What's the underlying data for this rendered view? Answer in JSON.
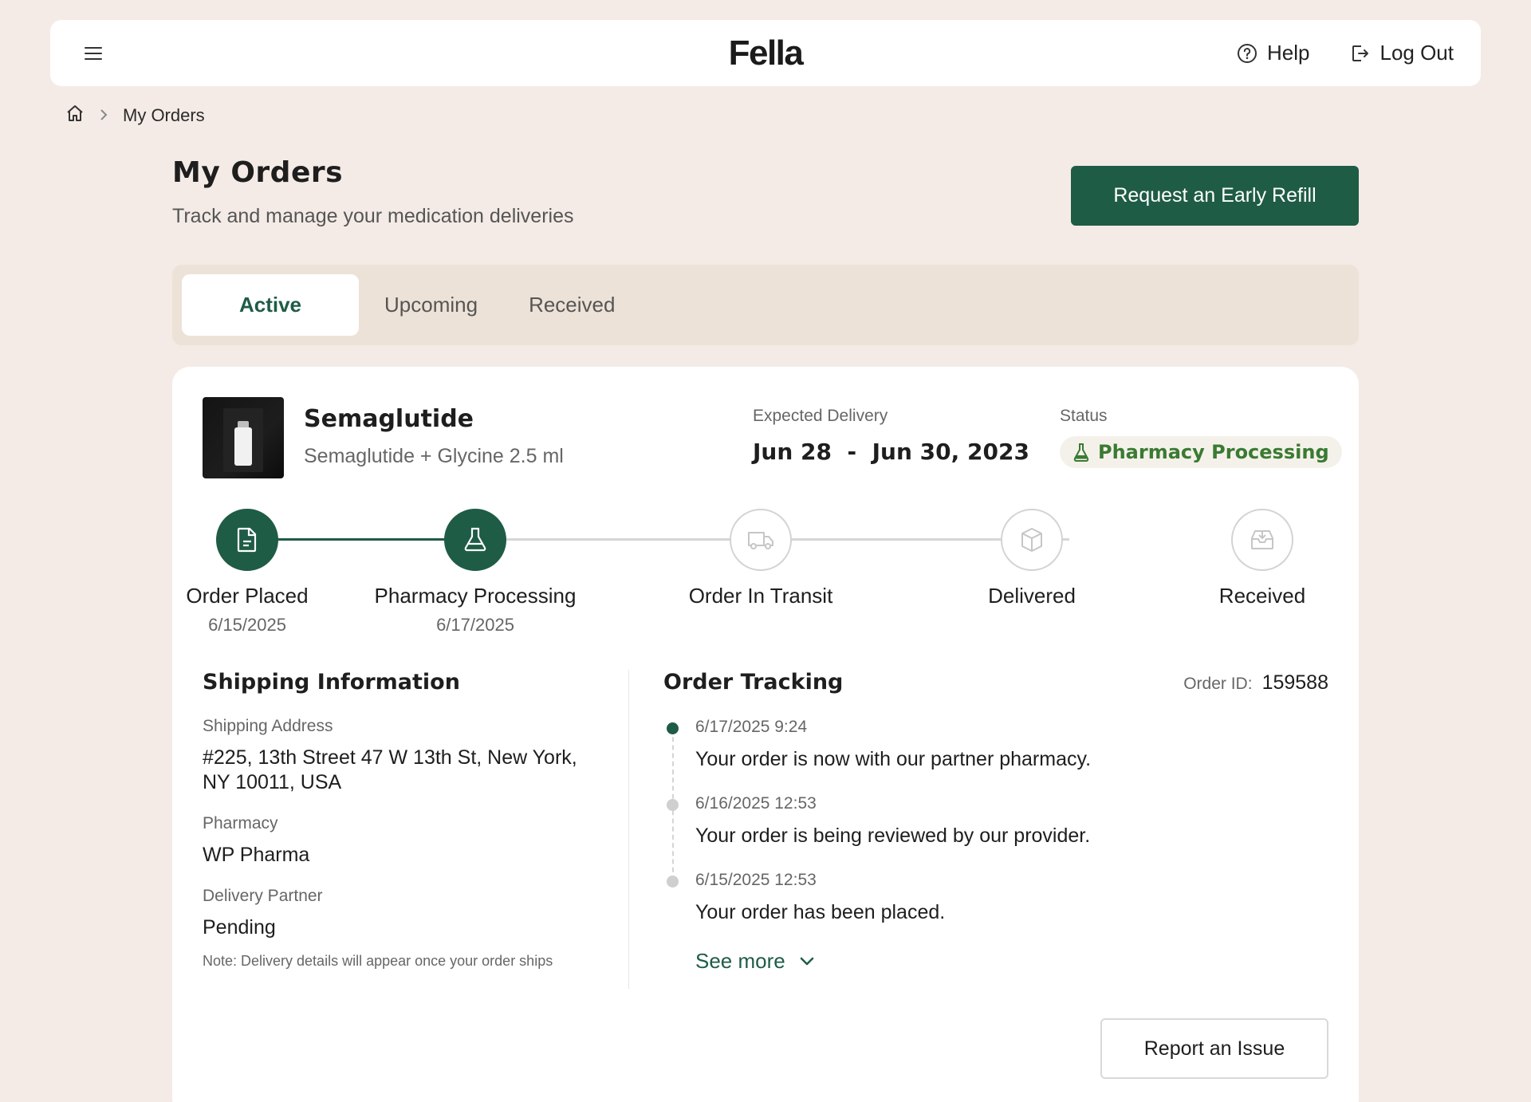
{
  "header": {
    "logo": "Fella",
    "help_label": "Help",
    "logout_label": "Log Out"
  },
  "breadcrumb": {
    "current": "My Orders"
  },
  "page": {
    "title": "My Orders",
    "subtitle": "Track and manage your medication deliveries",
    "refill_button": "Request an Early Refill"
  },
  "tabs": [
    {
      "label": "Active",
      "active": true
    },
    {
      "label": "Upcoming",
      "active": false
    },
    {
      "label": "Received",
      "active": false
    }
  ],
  "order": {
    "product_name": "Semaglutide",
    "product_desc": "Semaglutide + Glycine 2.5 ml",
    "expected_delivery_label": "Expected Delivery",
    "expected_delivery_value": "Jun 28  -  Jun 30, 2023",
    "status_label": "Status",
    "status_value": "Pharmacy Processing",
    "status_color": "#3a7a32",
    "steps": [
      {
        "name": "Order Placed",
        "date": "6/15/2025",
        "done": true,
        "icon": "document-icon"
      },
      {
        "name": "Pharmacy Processing",
        "date": "6/17/2025",
        "done": true,
        "icon": "flask-icon"
      },
      {
        "name": "Order In Transit",
        "date": "",
        "done": false,
        "icon": "truck-icon"
      },
      {
        "name": "Delivered",
        "date": "",
        "done": false,
        "icon": "package-icon"
      },
      {
        "name": "Received",
        "date": "",
        "done": false,
        "icon": "inbox-icon"
      }
    ],
    "shipping": {
      "title": "Shipping Information",
      "address_label": "Shipping Address",
      "address_line1": "#225, 13th Street 47 W 13th St, New York,",
      "address_line2": "NY 10011, USA",
      "pharmacy_label": "Pharmacy",
      "pharmacy_value": "WP Pharma",
      "partner_label": "Delivery Partner",
      "partner_value": "Pending",
      "note": "Note: Delivery details will appear once your order ships"
    },
    "tracking": {
      "title": "Order Tracking",
      "order_id_label": "Order ID:",
      "order_id_value": "159588",
      "events": [
        {
          "time": "6/17/2025 9:24",
          "message": "Your order is now with our partner pharmacy.",
          "current": true
        },
        {
          "time": "6/16/2025 12:53",
          "message": "Your order is being reviewed by our provider.",
          "current": false
        },
        {
          "time": "6/15/2025 12:53",
          "message": "Your order has been placed.",
          "current": false
        }
      ],
      "see_more": "See more"
    },
    "report_button": "Report an Issue"
  },
  "colors": {
    "accent": "#1f5c45",
    "background": "#f4ebe6",
    "tabs_bg": "#ede2d7"
  }
}
